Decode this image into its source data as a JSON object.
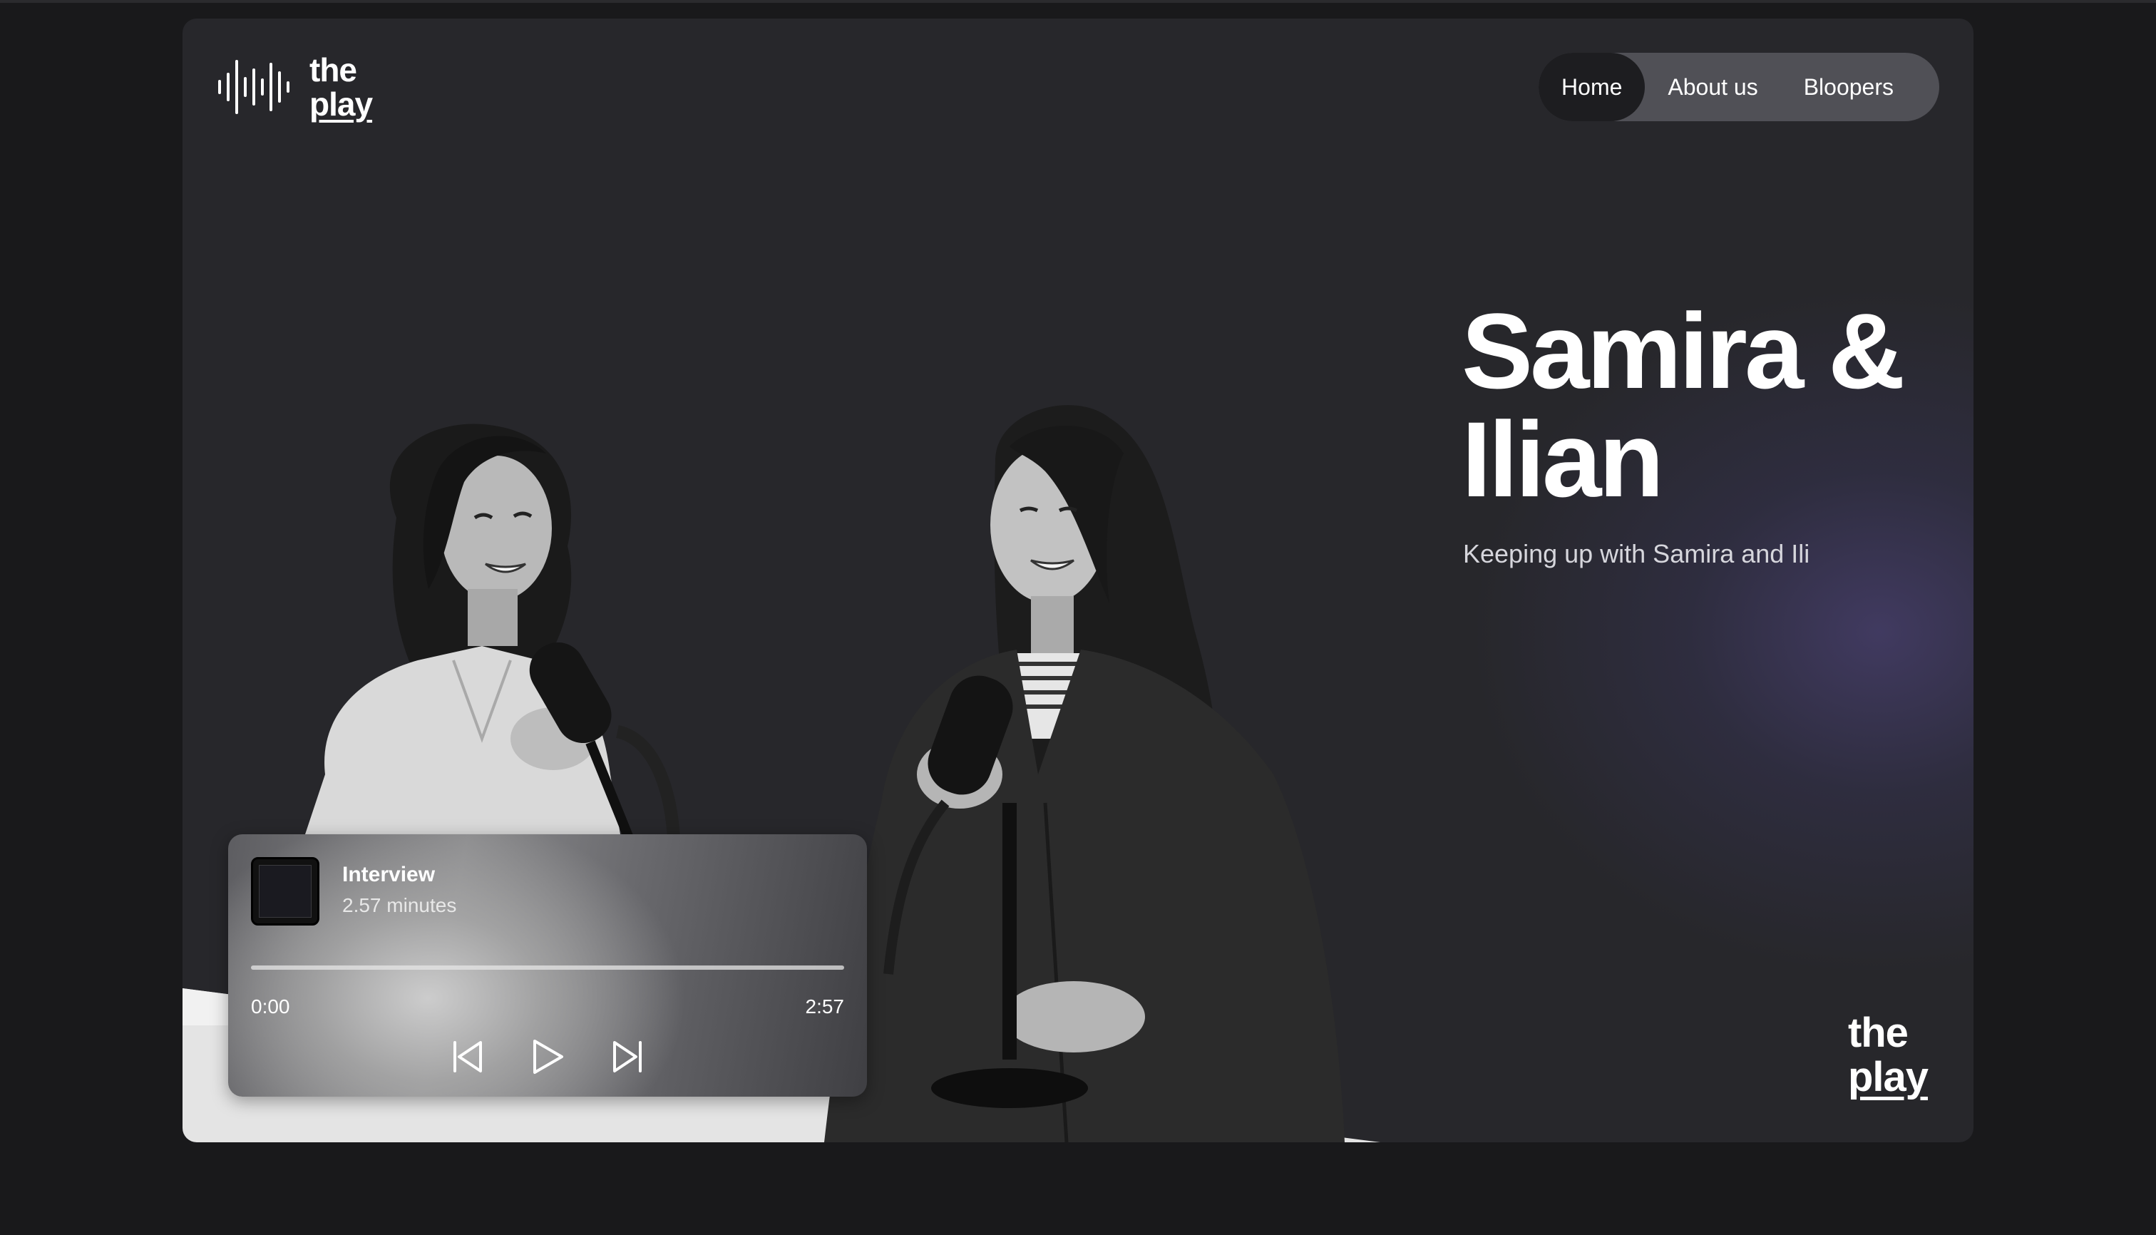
{
  "brand": {
    "line1": "the",
    "line2": "play",
    "icon": "soundwave-icon"
  },
  "nav": {
    "items": [
      {
        "label": "Home",
        "active": true
      },
      {
        "label": "About us",
        "active": false
      },
      {
        "label": "Bloopers",
        "active": false
      }
    ]
  },
  "hero": {
    "title": "Samira & Ilian",
    "subtitle": "Keeping up with Samira and Ili"
  },
  "player": {
    "track_title": "Interview",
    "track_meta": "2.57 minutes",
    "current_time": "0:00",
    "total_time": "2:57",
    "progress": 0,
    "controls": {
      "prev_icon": "skip-back-icon",
      "play_icon": "play-icon",
      "next_icon": "skip-forward-icon"
    }
  },
  "corner_brand": {
    "line1": "the",
    "line2": "play"
  },
  "colors": {
    "page_bg": "#19191b",
    "card_bg": "#27272b",
    "nav_bg": "#505056",
    "nav_active_bg": "#1d1d20",
    "glow": "#564a8c"
  }
}
